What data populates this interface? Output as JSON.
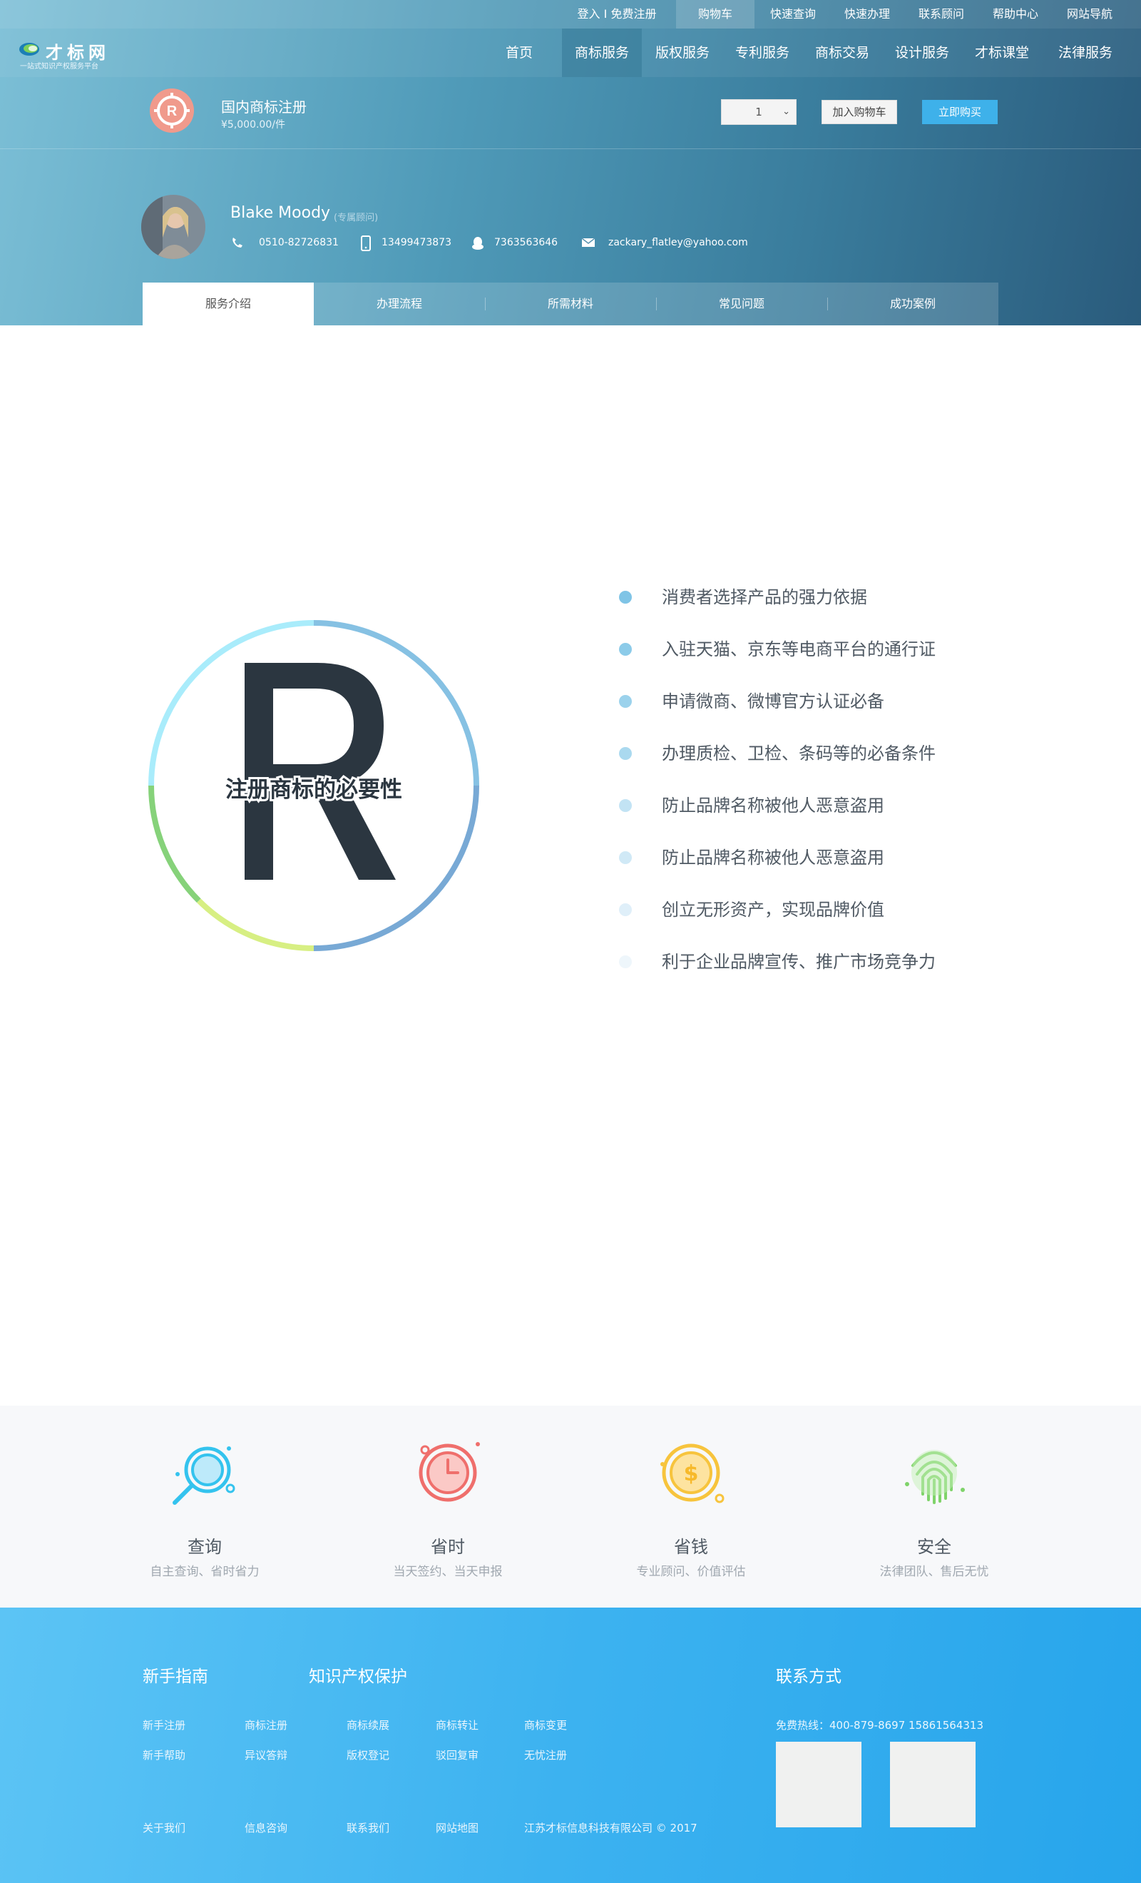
{
  "topbar": {
    "items": [
      {
        "label": "登入 I 免费注册"
      },
      {
        "label": "购物车"
      },
      {
        "label": "快速查询"
      },
      {
        "label": "快速办理"
      },
      {
        "label": "联系顾问"
      },
      {
        "label": "帮助中心"
      },
      {
        "label": "网站导航"
      }
    ]
  },
  "logo": {
    "title": "才标网",
    "subtitle": "一站式知识产权服务平台"
  },
  "nav": {
    "items": [
      {
        "label": "首页"
      },
      {
        "label": "商标服务"
      },
      {
        "label": "版权服务"
      },
      {
        "label": "专利服务"
      },
      {
        "label": "商标交易"
      },
      {
        "label": "设计服务"
      },
      {
        "label": "才标课堂"
      },
      {
        "label": "法律服务"
      }
    ]
  },
  "product": {
    "name": "国内商标注册",
    "price": "¥5,000.00/件",
    "quantity": "1",
    "add_to_cart": "加入购物车",
    "buy_now": "立即购买"
  },
  "consultant": {
    "name": "Blake Moody",
    "role": "(专属顾问)",
    "phone": "0510-82726831",
    "mobile": "13499473873",
    "qq": "7363563646",
    "email": "zackary_flatley@yahoo.com"
  },
  "tabs": [
    {
      "label": "服务介绍"
    },
    {
      "label": "办理流程"
    },
    {
      "label": "所需材料"
    },
    {
      "label": "常见问题"
    },
    {
      "label": "成功案例"
    }
  ],
  "necessity": {
    "title": "注册商标的必要性",
    "letter": "R",
    "items": [
      {
        "text": "消费者选择产品的强力依据",
        "color": "#7fc4e6"
      },
      {
        "text": "入驻天猫、京东等电商平台的通行证",
        "color": "#8ccbe9"
      },
      {
        "text": "申请微商、微博官方认证必备",
        "color": "#9bd2ec"
      },
      {
        "text": "办理质检、卫检、条码等的必备条件",
        "color": "#aad9ef"
      },
      {
        "text": "防止品牌名称被他人恶意盗用",
        "color": "#c2e3f4"
      },
      {
        "text": "防止品牌名称被他人恶意盗用",
        "color": "#d0e9f6"
      },
      {
        "text": "创立无形资产，实现品牌价值",
        "color": "#dfeff9"
      },
      {
        "text": "利于企业品牌宣传、推广市场竞争力",
        "color": "#eef6fb"
      }
    ]
  },
  "features": [
    {
      "title": "查询",
      "subtitle": "自主查询、省时省力",
      "icon": "magnifier-icon",
      "color": "#34c3ee"
    },
    {
      "title": "省时",
      "subtitle": "当天签约、当天申报",
      "icon": "clock-icon",
      "color": "#ef6f6c"
    },
    {
      "title": "省钱",
      "subtitle": "专业顾问、价值评估",
      "icon": "coin-icon",
      "color": "#f7c43d"
    },
    {
      "title": "安全",
      "subtitle": "法律团队、售后无忧",
      "icon": "fingerprint-icon",
      "color": "#7fd36a"
    }
  ],
  "footer": {
    "guide_title": "新手指南",
    "ip_title": "知识产权保护",
    "contact_title": "联系方式",
    "guide_links": [
      "新手注册",
      "新手帮助"
    ],
    "ip_col1": [
      "商标注册",
      "异议答辩"
    ],
    "ip_col2": [
      "商标续展",
      "版权登记"
    ],
    "ip_col3": [
      "商标转让",
      "驳回复审"
    ],
    "ip_col4": [
      "商标变更",
      "无忧注册"
    ],
    "hotline": "免费热线：400-879-8697    15861564313",
    "bottom_links": [
      "关于我们",
      "信息咨询",
      "联系我们",
      "网站地图"
    ],
    "copyright": "江苏才标信息科技有限公司 © 2017"
  }
}
